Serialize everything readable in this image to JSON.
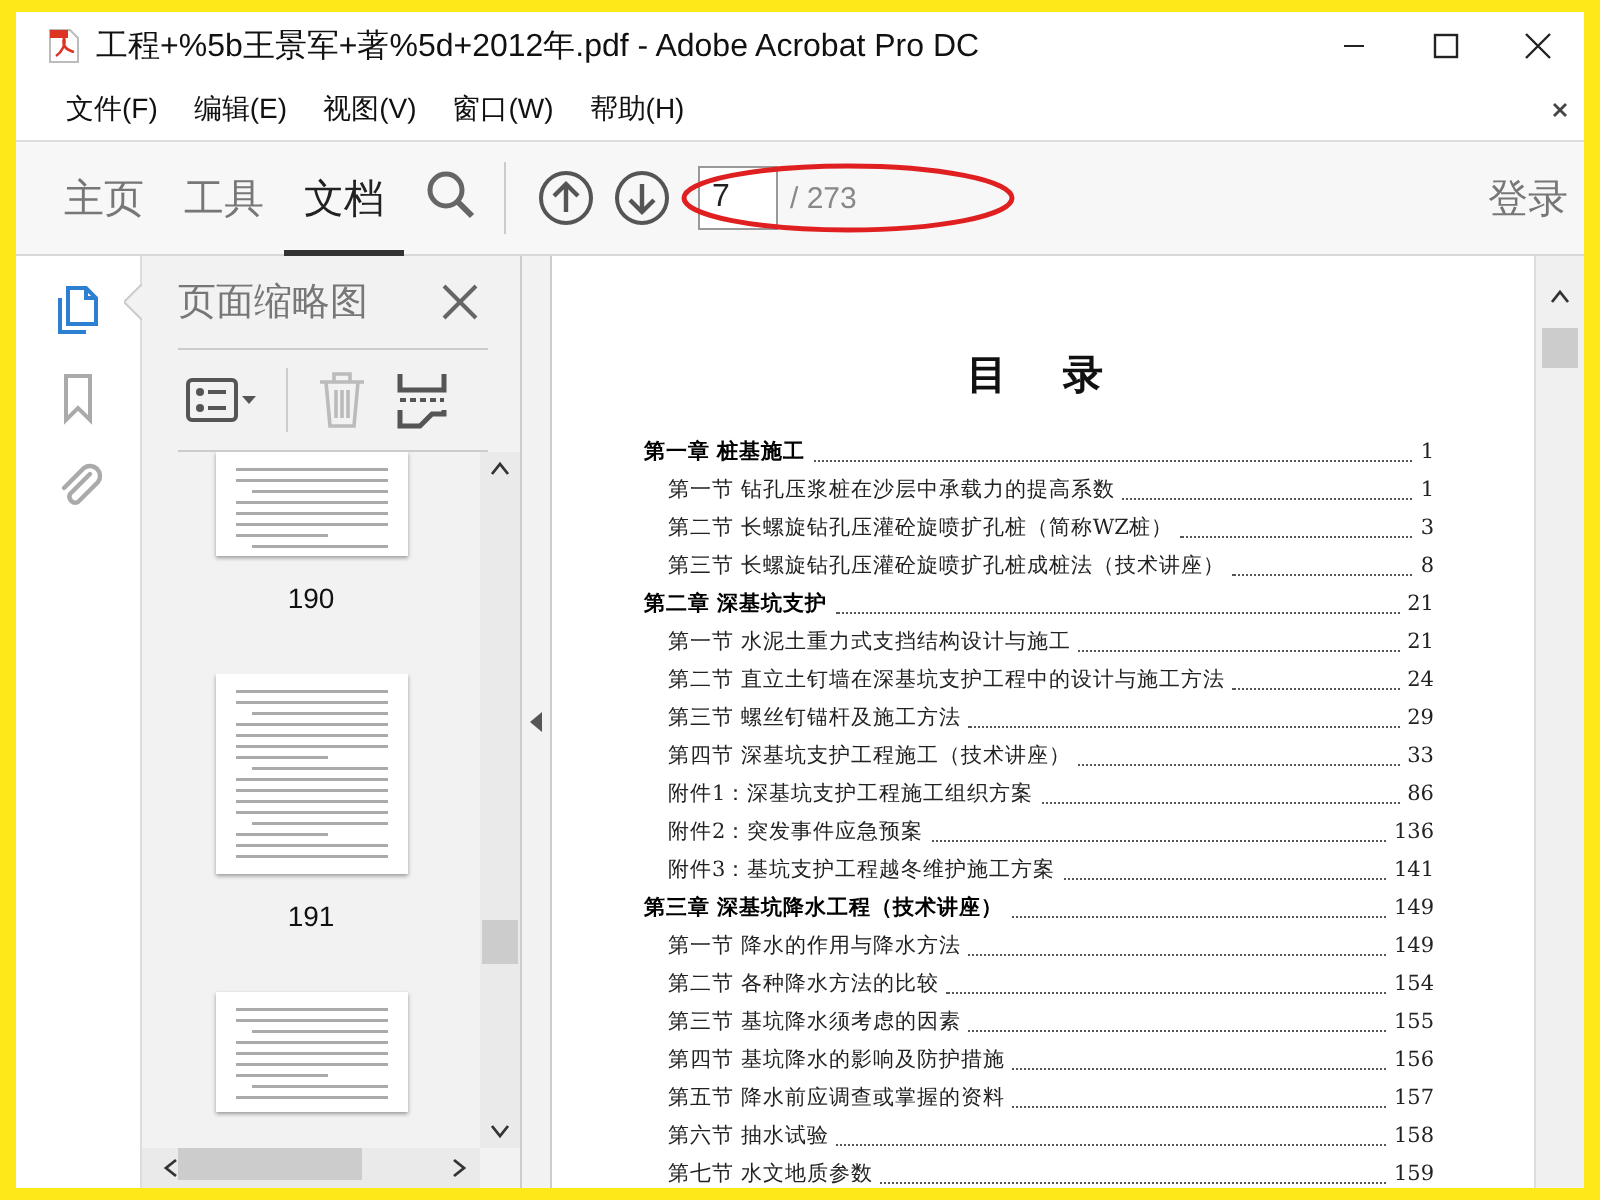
{
  "window": {
    "title": "工程+%5b王景军+著%5d+2012年.pdf - Adobe Acrobat Pro DC"
  },
  "menu": [
    "文件(F)",
    "编辑(E)",
    "视图(V)",
    "窗口(W)",
    "帮助(H)"
  ],
  "toolbar": {
    "tabs": [
      {
        "label": "主页",
        "selected": false
      },
      {
        "label": "工具",
        "selected": false
      },
      {
        "label": "文档",
        "selected": true
      }
    ],
    "page_field": {
      "value": "7"
    },
    "page_total": "/ 273",
    "sign_in": "登录"
  },
  "rail": [
    {
      "kind": "pages",
      "selected": true
    },
    {
      "kind": "bookmarks",
      "selected": false
    },
    {
      "kind": "attachments",
      "selected": false
    }
  ],
  "thumbnail_panel": {
    "title": "页面缩略图",
    "thumbnails": [
      {
        "label": "190"
      },
      {
        "label": "191"
      }
    ]
  },
  "document": {
    "title": "目　录",
    "entries": [
      {
        "kind": "chapter",
        "text": "第一章  桩基施工",
        "page": "1"
      },
      {
        "kind": "section",
        "text": "第一节  钻孔压浆桩在沙层中承载力的提高系数",
        "page": "1"
      },
      {
        "kind": "section",
        "text": "第二节  长螺旋钻孔压灌砼旋喷扩孔桩（简称WZ桩）",
        "page": "3"
      },
      {
        "kind": "section",
        "text": "第三节  长螺旋钻孔压灌砼旋喷扩孔桩成桩法（技术讲座）",
        "page": "8"
      },
      {
        "kind": "chapter",
        "text": "第二章  深基坑支护",
        "page": "21"
      },
      {
        "kind": "section",
        "text": "第一节  水泥土重力式支挡结构设计与施工",
        "page": "21"
      },
      {
        "kind": "section",
        "text": "第二节  直立土钉墙在深基坑支护工程中的设计与施工方法",
        "page": "24"
      },
      {
        "kind": "section",
        "text": "第三节  螺丝钉锚杆及施工方法",
        "page": "29"
      },
      {
        "kind": "section",
        "text": "第四节  深基坑支护工程施工（技术讲座）",
        "page": "33"
      },
      {
        "kind": "section",
        "text": "附件1：深基坑支护工程施工组织方案",
        "page": "86"
      },
      {
        "kind": "section",
        "text": "附件2：突发事件应急预案",
        "page": "136"
      },
      {
        "kind": "section",
        "text": "附件3：基坑支护工程越冬维护施工方案",
        "page": "141"
      },
      {
        "kind": "chapter",
        "text": "第三章  深基坑降水工程（技术讲座）",
        "page": "149"
      },
      {
        "kind": "section",
        "text": "第一节  降水的作用与降水方法",
        "page": "149"
      },
      {
        "kind": "section",
        "text": "第二节  各种降水方法的比较",
        "page": "154"
      },
      {
        "kind": "section",
        "text": "第三节  基坑降水须考虑的因素",
        "page": "155"
      },
      {
        "kind": "section",
        "text": "第四节  基坑降水的影响及防护措施",
        "page": "156"
      },
      {
        "kind": "section",
        "text": "第五节  降水前应调查或掌握的资料",
        "page": "157"
      },
      {
        "kind": "section",
        "text": "第六节  抽水试验",
        "page": "158"
      },
      {
        "kind": "section",
        "text": "第七节  水文地质参数",
        "page": "159"
      }
    ]
  }
}
